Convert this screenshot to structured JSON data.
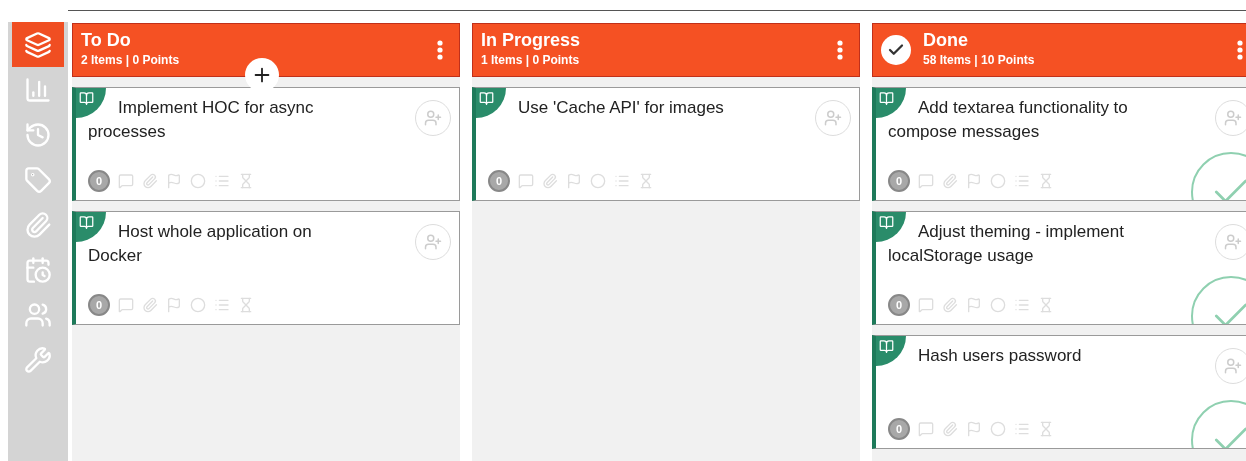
{
  "sidebar": {
    "items": [
      {
        "selected": true
      },
      {
        "selected": false
      },
      {
        "selected": false
      },
      {
        "selected": false
      },
      {
        "selected": false
      },
      {
        "selected": false
      },
      {
        "selected": false
      },
      {
        "selected": false
      }
    ]
  },
  "columns": [
    {
      "title": "To Do",
      "summary": "2 Items | 0 Points",
      "done": false,
      "add_button": true,
      "cards": [
        {
          "title": "Implement HOC for async processes",
          "points": "0",
          "done": false
        },
        {
          "title": "Host whole application on Docker",
          "points": "0",
          "done": false
        }
      ]
    },
    {
      "title": "In Progress",
      "summary": "1 Items | 0 Points",
      "done": false,
      "add_button": false,
      "cards": [
        {
          "title": "Use 'Cache API' for images",
          "points": "0",
          "done": false
        }
      ]
    },
    {
      "title": "Done",
      "summary": "58 Items | 10 Points",
      "done": true,
      "add_button": false,
      "cards": [
        {
          "title": "Add textarea functionality to compose messages",
          "points": "0",
          "done": true
        },
        {
          "title": "Adjust theming - implement localStorage usage",
          "points": "0",
          "done": true
        },
        {
          "title": "Hash users password",
          "points": "0",
          "done": true
        }
      ]
    }
  ]
}
